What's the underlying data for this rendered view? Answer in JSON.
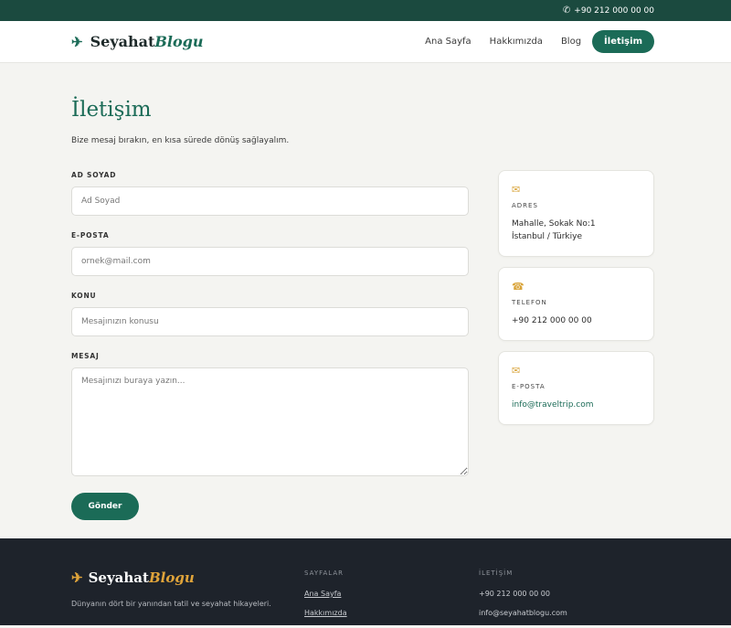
{
  "topbar": {
    "phone_icon": "phone-icon",
    "phone": "+90 212 000 00 00"
  },
  "brand": {
    "icon": "plane-icon",
    "name_main": "Seyahat",
    "name_accent": "Blogu"
  },
  "nav": {
    "items": [
      {
        "label": "Ana Sayfa"
      },
      {
        "label": "Hakkımızda"
      },
      {
        "label": "Blog"
      },
      {
        "label": "İletişim",
        "active": true
      }
    ]
  },
  "page": {
    "title": "İletişim",
    "subtitle": "Bize mesaj bırakın, en kısa sürede dönüş sağlayalım."
  },
  "form": {
    "name": {
      "label": "AD SOYAD",
      "placeholder": "Ad Soyad",
      "value": ""
    },
    "email": {
      "label": "E-POSTA",
      "placeholder": "ornek@mail.com",
      "value": ""
    },
    "subject": {
      "label": "KONU",
      "placeholder": "Mesajınızın konusu",
      "value": ""
    },
    "message": {
      "label": "MESAJ",
      "placeholder": "Mesajınızı buraya yazın...",
      "value": ""
    },
    "submit_label": "Gönder"
  },
  "contact_cards": {
    "address": {
      "icon": "mail-icon",
      "label": "ADRES",
      "line1": "Mahalle, Sokak No:1",
      "line2": "İstanbul / Türkiye"
    },
    "phone": {
      "icon": "phone-icon",
      "label": "TELEFON",
      "value": "+90 212 000 00 00"
    },
    "email": {
      "icon": "mail-icon",
      "label": "E-POSTA",
      "value": "info@traveltrip.com"
    }
  },
  "footer": {
    "brand_main": "Seyahat",
    "brand_accent": "Blogu",
    "tagline": "Dünyanın dört bir yanından tatil ve seyahat hikayeleri.",
    "pages_heading": "SAYFALAR",
    "pages": [
      "Ana Sayfa",
      "Hakkımızda"
    ],
    "contact_heading": "İLETİŞİM",
    "contact_phone": "+90 212 000 00 00",
    "contact_email": "info@seyahatblogu.com"
  },
  "colors": {
    "primary": "#1b6b57",
    "topbar": "#1b4a3f",
    "accent": "#d9a43a",
    "footer_bg": "#1e232b",
    "page_bg": "#f4f4f1"
  }
}
